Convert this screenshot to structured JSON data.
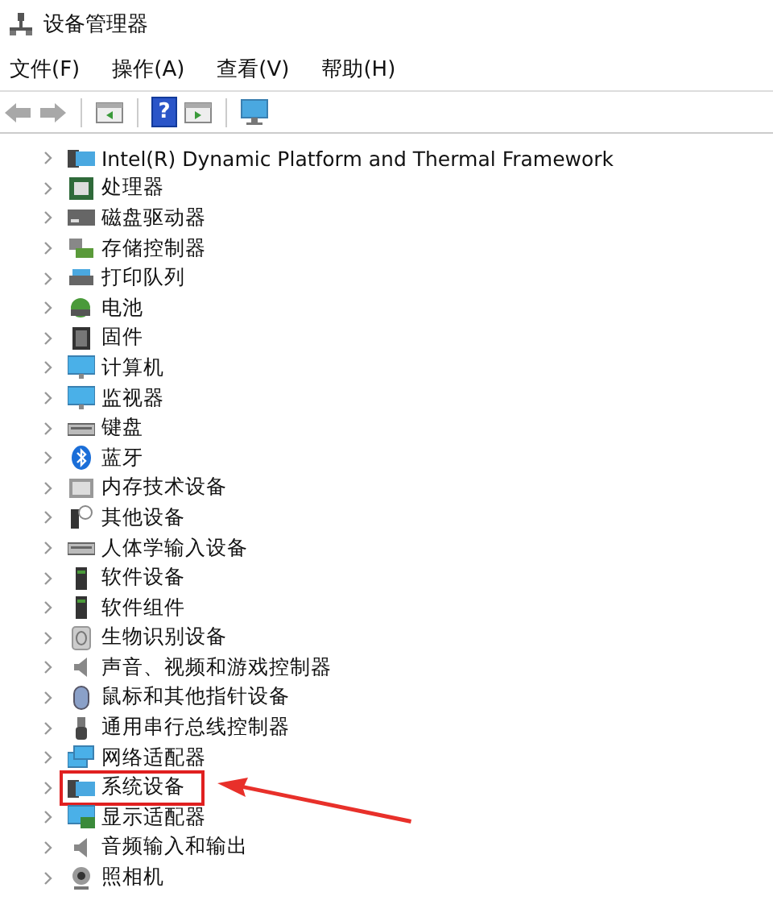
{
  "window": {
    "title": "设备管理器"
  },
  "menu": [
    "文件(F)",
    "操作(A)",
    "查看(V)",
    "帮助(H)"
  ],
  "toolbar": [
    {
      "kind": "back",
      "disabled": true
    },
    {
      "kind": "forward",
      "disabled": true
    },
    {
      "kind": "separator"
    },
    {
      "kind": "panel"
    },
    {
      "kind": "separator"
    },
    {
      "kind": "help",
      "glyph": "?"
    },
    {
      "kind": "run"
    },
    {
      "kind": "separator"
    },
    {
      "kind": "scan"
    }
  ],
  "tree": [
    {
      "label": "Intel(R) Dynamic Platform and Thermal Framework",
      "kind": "folder",
      "expanded": false,
      "highlighted": false
    },
    {
      "label": "处理器",
      "kind": "cpu",
      "expanded": false,
      "highlighted": false
    },
    {
      "label": "磁盘驱动器",
      "kind": "disk",
      "expanded": false,
      "highlighted": false
    },
    {
      "label": "存储控制器",
      "kind": "storage",
      "expanded": false,
      "highlighted": false
    },
    {
      "label": "打印队列",
      "kind": "printer",
      "expanded": false,
      "highlighted": false
    },
    {
      "label": "电池",
      "kind": "battery",
      "expanded": false,
      "highlighted": false
    },
    {
      "label": "固件",
      "kind": "firmware",
      "expanded": false,
      "highlighted": false
    },
    {
      "label": "计算机",
      "kind": "monitor",
      "expanded": false,
      "highlighted": false
    },
    {
      "label": "监视器",
      "kind": "monitor",
      "expanded": false,
      "highlighted": false
    },
    {
      "label": "键盘",
      "kind": "keyboard",
      "expanded": false,
      "highlighted": false
    },
    {
      "label": "蓝牙",
      "kind": "bluetooth",
      "expanded": false,
      "highlighted": false
    },
    {
      "label": "内存技术设备",
      "kind": "memory",
      "expanded": false,
      "highlighted": false
    },
    {
      "label": "其他设备",
      "kind": "other",
      "expanded": false,
      "highlighted": false
    },
    {
      "label": "人体学输入设备",
      "kind": "keyboard",
      "expanded": false,
      "highlighted": false
    },
    {
      "label": "软件设备",
      "kind": "tower",
      "expanded": false,
      "highlighted": false
    },
    {
      "label": "软件组件",
      "kind": "tower",
      "expanded": false,
      "highlighted": false
    },
    {
      "label": "生物识别设备",
      "kind": "biometric",
      "expanded": false,
      "highlighted": false
    },
    {
      "label": "声音、视频和游戏控制器",
      "kind": "speaker",
      "expanded": false,
      "highlighted": false
    },
    {
      "label": "鼠标和其他指针设备",
      "kind": "mouse",
      "expanded": false,
      "highlighted": false
    },
    {
      "label": "通用串行总线控制器",
      "kind": "usb",
      "expanded": false,
      "highlighted": false
    },
    {
      "label": "网络适配器",
      "kind": "network",
      "expanded": false,
      "highlighted": false
    },
    {
      "label": "系统设备",
      "kind": "folder",
      "expanded": false,
      "highlighted": true
    },
    {
      "label": "显示适配器",
      "kind": "display",
      "expanded": false,
      "highlighted": false
    },
    {
      "label": "音频输入和输出",
      "kind": "speaker",
      "expanded": false,
      "highlighted": false
    },
    {
      "label": "照相机",
      "kind": "camera",
      "expanded": false,
      "highlighted": false
    }
  ]
}
